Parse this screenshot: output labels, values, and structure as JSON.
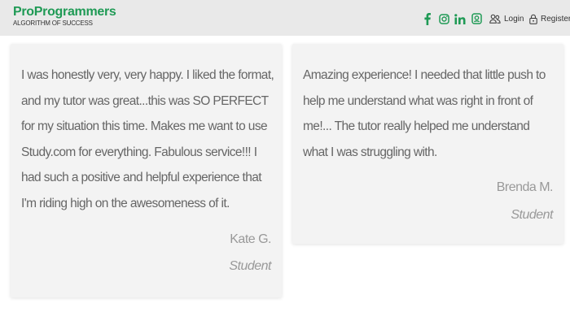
{
  "header": {
    "brand_name": "ProProgrammers",
    "brand_tagline": "ALGORITHM OF SUCCESS",
    "social_icons": [
      "facebook-icon",
      "instagram-icon",
      "linkedin-icon",
      "chat-icon"
    ],
    "login_label": "Login",
    "register_label": "Register",
    "brand_color": "#1f9a55"
  },
  "testimonials": [
    {
      "text": "I was honestly very, very happy. I liked the format, and my tutor was great...this was SO PERFECT for my situation this time. Makes me want to use Study.com for everything. Fabulous service!!! I had such a positive and helpful experience that I'm riding high on the awesomeness of it.",
      "author": "Kate G.",
      "role": "Student"
    },
    {
      "text": "Amazing experience! I needed that little push to help me understand what was right in front of me!... The tutor really helped me understand what I was struggling with.",
      "author": "Brenda M.",
      "role": "Student"
    }
  ]
}
